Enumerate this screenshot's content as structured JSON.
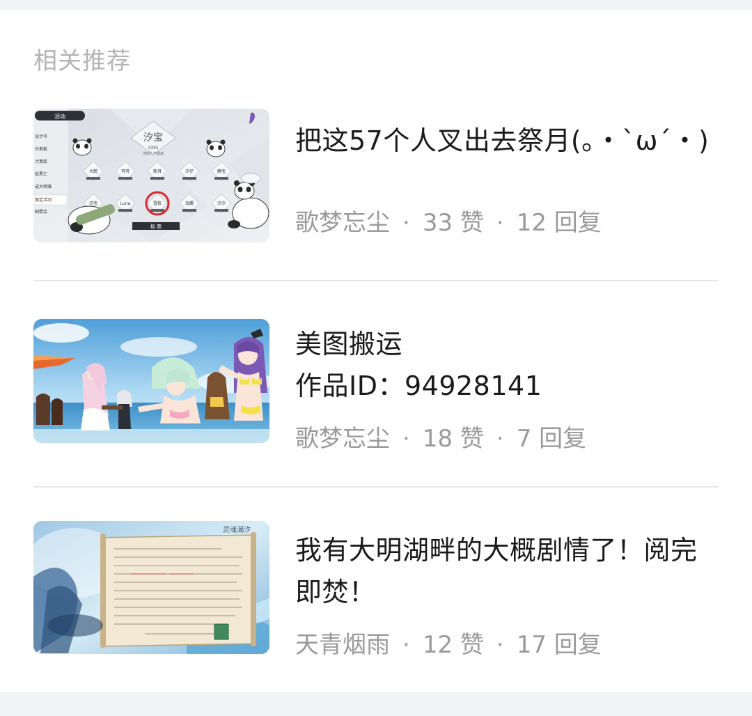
{
  "section_title": "相关推荐",
  "posts": [
    {
      "title": "把这57个人叉出去祭月(。・`ω´・)",
      "author": "歌梦忘尘",
      "likes": "33 赞",
      "replies": "12 回复",
      "thumb": {
        "top_tab": "活动",
        "banner": "汐宝",
        "banner_sub": "3395",
        "banner_sub2": "当前人气最高",
        "cards_row1": [
          "大鹤",
          "可可",
          "新月",
          "汐仔",
          "静宝"
        ],
        "cards_row2": [
          "汐宝",
          "Luna",
          "雪枝",
          "海螺",
          "汐汐"
        ],
        "button": "投 票",
        "left_menu": [
          "设计号",
          "分推板",
          "计算库",
          "投票汇",
          "成大转赠",
          "限定活动",
          "剧情会"
        ]
      }
    },
    {
      "title": "美图搬运\n作品ID：94928141",
      "author": "歌梦忘尘",
      "likes": "18 赞",
      "replies": "7 回复"
    },
    {
      "title": "我有大明湖畔的大概剧情了！阅完即焚！",
      "author": "天青烟雨",
      "likes": "12 赞",
      "replies": "17 回复",
      "thumb": {
        "logo_text": "灵魂潮汐"
      }
    }
  ],
  "meta_separator": "·",
  "colors": {
    "page_bg": "#f3f4f6",
    "card_bg": "#ffffff",
    "title_text": "#1a1a1a",
    "meta_text": "#9a9a9a",
    "section_title_text": "#b4b4b4",
    "divider": "#e6e6e6"
  }
}
